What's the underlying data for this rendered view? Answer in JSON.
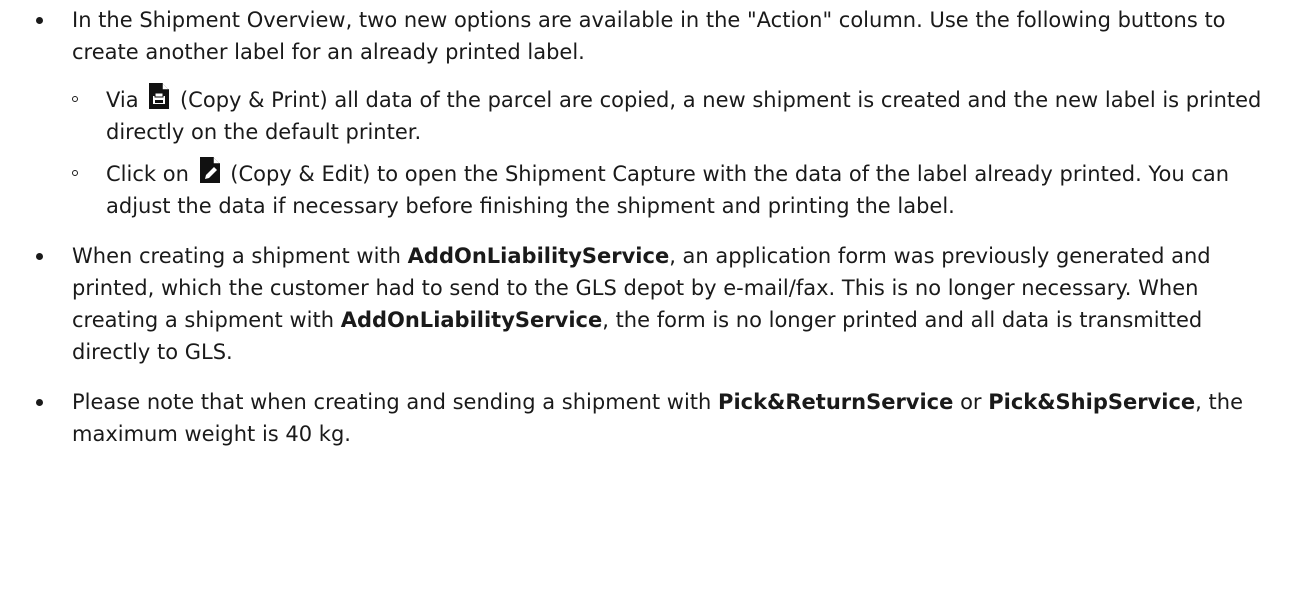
{
  "items": [
    {
      "text": "In the Shipment Overview, two new options are available in the \"Action\" column. Use the following buttons to create another label for an already printed label.",
      "subitems": [
        {
          "before": "Via",
          "icon": "copy-print-icon",
          "after": "(Copy & Print) all data of the parcel are copied, a new shipment is created and the new label is printed directly on the default printer."
        },
        {
          "before": "Click on",
          "icon": "copy-edit-icon",
          "after": "(Copy & Edit) to open the Shipment Capture with the data of the label already printed. You can adjust the data if necessary before finishing the shipment and printing the label."
        }
      ]
    },
    {
      "t1": "When creating a shipment with",
      "b1": "AddOnLiabilityService",
      "t2": ", an application form was previously generated and printed, which the customer had to send to the GLS depot by e-mail/fax. This is no longer necessary. When creating a shipment with",
      "b2": "AddOnLiabilityService",
      "t3": ", the form is no longer printed and all data is transmitted directly to GLS."
    },
    {
      "t1": "Please note that when creating and sending a shipment with",
      "b1": "Pick&ReturnService",
      "t2": "or",
      "b2": "Pick&ShipService",
      "t3": ", the maximum weight is 40 kg."
    }
  ]
}
